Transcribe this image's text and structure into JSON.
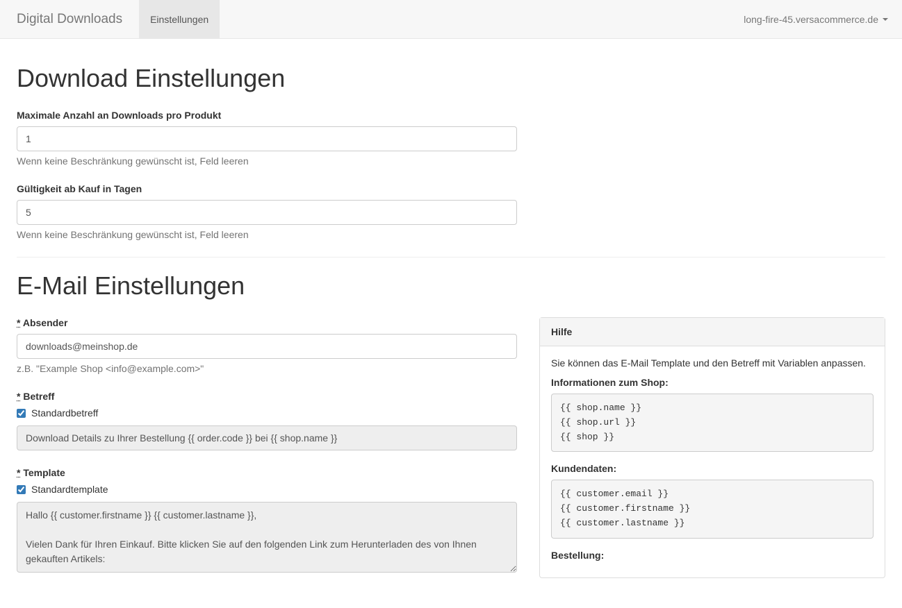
{
  "navbar": {
    "brand": "Digital Downloads",
    "tab": "Einstellungen",
    "shop": "long-fire-45.versacommerce.de"
  },
  "downloadSettings": {
    "heading": "Download Einstellungen",
    "maxDownloads": {
      "label": "Maximale Anzahl an Downloads pro Produkt",
      "value": "1",
      "help": "Wenn keine Beschränkung gewünscht ist, Feld leeren"
    },
    "validityDays": {
      "label": "Gültigkeit ab Kauf in Tagen",
      "value": "5",
      "help": "Wenn keine Beschränkung gewünscht ist, Feld leeren"
    }
  },
  "emailSettings": {
    "heading": "E-Mail Einstellungen",
    "requiredMark": "*",
    "sender": {
      "label": "Absender",
      "value": "downloads@meinshop.de",
      "help": "z.B. \"Example Shop <info@example.com>\""
    },
    "subject": {
      "label": "Betreff",
      "checkboxLabel": "Standardbetreff",
      "value": "Download Details zu Ihrer Bestellung {{ order.code }} bei {{ shop.name }}"
    },
    "template": {
      "label": "Template",
      "checkboxLabel": "Standardtemplate",
      "value": "Hallo {{ customer.firstname }} {{ customer.lastname }},\n\nVielen Dank für Ihren Einkauf. Bitte klicken Sie auf den folgenden Link zum Herunterladen des von Ihnen gekauften Artikels:"
    }
  },
  "help": {
    "heading": "Hilfe",
    "intro": "Sie können das E-Mail Template und den Betreff mit Variablen anpassen.",
    "shopInfoLabel": "Informationen zum Shop:",
    "shopInfoCode": "{{ shop.name }}\n{{ shop.url }}\n{{ shop }}",
    "customerLabel": "Kundendaten:",
    "customerCode": "{{ customer.email }}\n{{ customer.firstname }}\n{{ customer.lastname }}",
    "orderLabel": "Bestellung:"
  }
}
